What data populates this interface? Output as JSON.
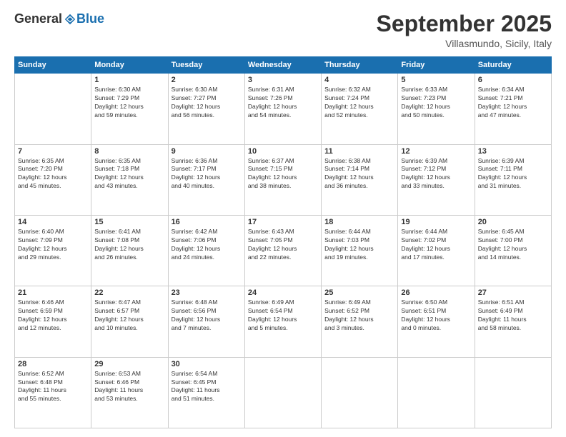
{
  "logo": {
    "general": "General",
    "blue": "Blue"
  },
  "title": "September 2025",
  "location": "Villasmundo, Sicily, Italy",
  "weekdays": [
    "Sunday",
    "Monday",
    "Tuesday",
    "Wednesday",
    "Thursday",
    "Friday",
    "Saturday"
  ],
  "weeks": [
    [
      {
        "day": "",
        "info": ""
      },
      {
        "day": "1",
        "info": "Sunrise: 6:30 AM\nSunset: 7:29 PM\nDaylight: 12 hours\nand 59 minutes."
      },
      {
        "day": "2",
        "info": "Sunrise: 6:30 AM\nSunset: 7:27 PM\nDaylight: 12 hours\nand 56 minutes."
      },
      {
        "day": "3",
        "info": "Sunrise: 6:31 AM\nSunset: 7:26 PM\nDaylight: 12 hours\nand 54 minutes."
      },
      {
        "day": "4",
        "info": "Sunrise: 6:32 AM\nSunset: 7:24 PM\nDaylight: 12 hours\nand 52 minutes."
      },
      {
        "day": "5",
        "info": "Sunrise: 6:33 AM\nSunset: 7:23 PM\nDaylight: 12 hours\nand 50 minutes."
      },
      {
        "day": "6",
        "info": "Sunrise: 6:34 AM\nSunset: 7:21 PM\nDaylight: 12 hours\nand 47 minutes."
      }
    ],
    [
      {
        "day": "7",
        "info": "Sunrise: 6:35 AM\nSunset: 7:20 PM\nDaylight: 12 hours\nand 45 minutes."
      },
      {
        "day": "8",
        "info": "Sunrise: 6:35 AM\nSunset: 7:18 PM\nDaylight: 12 hours\nand 43 minutes."
      },
      {
        "day": "9",
        "info": "Sunrise: 6:36 AM\nSunset: 7:17 PM\nDaylight: 12 hours\nand 40 minutes."
      },
      {
        "day": "10",
        "info": "Sunrise: 6:37 AM\nSunset: 7:15 PM\nDaylight: 12 hours\nand 38 minutes."
      },
      {
        "day": "11",
        "info": "Sunrise: 6:38 AM\nSunset: 7:14 PM\nDaylight: 12 hours\nand 36 minutes."
      },
      {
        "day": "12",
        "info": "Sunrise: 6:39 AM\nSunset: 7:12 PM\nDaylight: 12 hours\nand 33 minutes."
      },
      {
        "day": "13",
        "info": "Sunrise: 6:39 AM\nSunset: 7:11 PM\nDaylight: 12 hours\nand 31 minutes."
      }
    ],
    [
      {
        "day": "14",
        "info": "Sunrise: 6:40 AM\nSunset: 7:09 PM\nDaylight: 12 hours\nand 29 minutes."
      },
      {
        "day": "15",
        "info": "Sunrise: 6:41 AM\nSunset: 7:08 PM\nDaylight: 12 hours\nand 26 minutes."
      },
      {
        "day": "16",
        "info": "Sunrise: 6:42 AM\nSunset: 7:06 PM\nDaylight: 12 hours\nand 24 minutes."
      },
      {
        "day": "17",
        "info": "Sunrise: 6:43 AM\nSunset: 7:05 PM\nDaylight: 12 hours\nand 22 minutes."
      },
      {
        "day": "18",
        "info": "Sunrise: 6:44 AM\nSunset: 7:03 PM\nDaylight: 12 hours\nand 19 minutes."
      },
      {
        "day": "19",
        "info": "Sunrise: 6:44 AM\nSunset: 7:02 PM\nDaylight: 12 hours\nand 17 minutes."
      },
      {
        "day": "20",
        "info": "Sunrise: 6:45 AM\nSunset: 7:00 PM\nDaylight: 12 hours\nand 14 minutes."
      }
    ],
    [
      {
        "day": "21",
        "info": "Sunrise: 6:46 AM\nSunset: 6:59 PM\nDaylight: 12 hours\nand 12 minutes."
      },
      {
        "day": "22",
        "info": "Sunrise: 6:47 AM\nSunset: 6:57 PM\nDaylight: 12 hours\nand 10 minutes."
      },
      {
        "day": "23",
        "info": "Sunrise: 6:48 AM\nSunset: 6:56 PM\nDaylight: 12 hours\nand 7 minutes."
      },
      {
        "day": "24",
        "info": "Sunrise: 6:49 AM\nSunset: 6:54 PM\nDaylight: 12 hours\nand 5 minutes."
      },
      {
        "day": "25",
        "info": "Sunrise: 6:49 AM\nSunset: 6:52 PM\nDaylight: 12 hours\nand 3 minutes."
      },
      {
        "day": "26",
        "info": "Sunrise: 6:50 AM\nSunset: 6:51 PM\nDaylight: 12 hours\nand 0 minutes."
      },
      {
        "day": "27",
        "info": "Sunrise: 6:51 AM\nSunset: 6:49 PM\nDaylight: 11 hours\nand 58 minutes."
      }
    ],
    [
      {
        "day": "28",
        "info": "Sunrise: 6:52 AM\nSunset: 6:48 PM\nDaylight: 11 hours\nand 55 minutes."
      },
      {
        "day": "29",
        "info": "Sunrise: 6:53 AM\nSunset: 6:46 PM\nDaylight: 11 hours\nand 53 minutes."
      },
      {
        "day": "30",
        "info": "Sunrise: 6:54 AM\nSunset: 6:45 PM\nDaylight: 11 hours\nand 51 minutes."
      },
      {
        "day": "",
        "info": ""
      },
      {
        "day": "",
        "info": ""
      },
      {
        "day": "",
        "info": ""
      },
      {
        "day": "",
        "info": ""
      }
    ]
  ]
}
